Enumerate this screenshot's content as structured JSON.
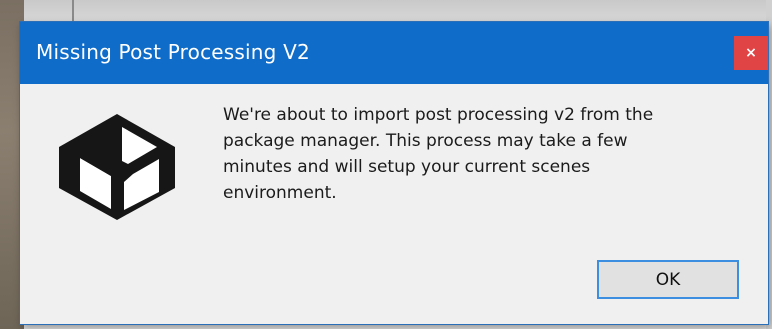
{
  "dialog": {
    "title": "Missing Post Processing V2",
    "close_glyph": "×",
    "icon": "unity-logo-icon",
    "message_lines": [
      "We're about to import post processing v2 from the",
      "package manager. This process may take a few",
      "minutes and will setup your current scenes",
      "environment."
    ],
    "ok_label": "OK"
  },
  "colors": {
    "titlebar": "#0f6cc8",
    "close_button": "#e04444",
    "ok_border": "#3c8ee0",
    "body_background": "#f0f0f0"
  }
}
